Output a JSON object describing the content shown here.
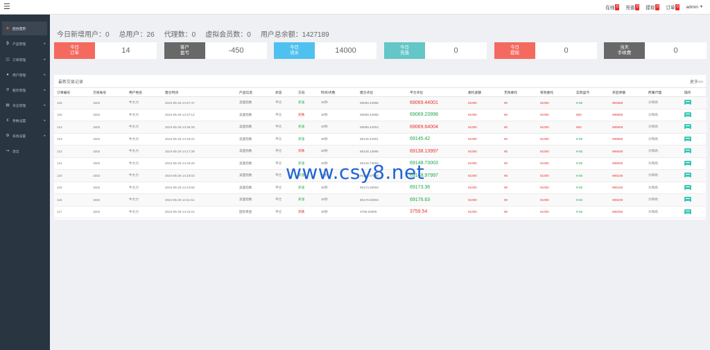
{
  "topbar": {
    "menu_icon": "hamburger-icon",
    "items": [
      {
        "label": "在线",
        "count": "0"
      },
      {
        "label": "充值",
        "count": "0"
      },
      {
        "label": "提现",
        "count": "0"
      },
      {
        "label": "订单",
        "count": "0"
      }
    ],
    "user": "admin"
  },
  "sidebar": {
    "items": [
      {
        "label": "后台首页",
        "icon": "dashboard-icon"
      },
      {
        "label": "产品管理",
        "icon": "product-icon"
      },
      {
        "label": "订单管理",
        "icon": "order-icon"
      },
      {
        "label": "用户管理",
        "icon": "user-icon"
      },
      {
        "label": "服务管理",
        "icon": "service-icon"
      },
      {
        "label": "日志管理",
        "icon": "log-icon"
      },
      {
        "label": "参数设置",
        "icon": "settings-icon"
      },
      {
        "label": "系统设置",
        "icon": "system-icon"
      },
      {
        "label": "退出",
        "icon": "logout-icon"
      }
    ]
  },
  "summary": {
    "new_users": "今日新增用户：0",
    "total_users": "总用户：26",
    "agents": "代理数：0",
    "virtual_members": "虚拟会员数：0",
    "total_balance": "用户总余额：1427189"
  },
  "cards": [
    {
      "label": "今日\n订单",
      "value": "14",
      "color": "#f46a5f"
    },
    {
      "label": "客户\n盈亏",
      "value": "-450",
      "color": "#686868"
    },
    {
      "label": "今日\n流水",
      "value": "14000",
      "color": "#4fc1f0"
    },
    {
      "label": "今日\n充值",
      "value": "0",
      "color": "#64c6c6"
    },
    {
      "label": "今日\n提现",
      "value": "0",
      "color": "#f46a5f"
    },
    {
      "label": "当天\n手续费",
      "value": "0",
      "color": "#686868"
    }
  ],
  "table": {
    "title": "最新交易记录",
    "more": "更多>>",
    "headers": [
      "订单编号",
      "交易账号",
      "用户姓名",
      "建仓时间",
      "产品信息",
      "状态",
      "方向",
      "时间/点数",
      "建仓点位",
      "平仓点位",
      "委托金额",
      "无效委托",
      "有效委托",
      "实际盈亏",
      "买后余额",
      "所属代理",
      "操作"
    ],
    "rows": [
      {
        "id": "126",
        "account": "1602",
        "name": "牛大力",
        "time": "2024-05-26 14:37:47",
        "product": "美国指数",
        "status": "平仓",
        "dir": "买涨",
        "dur": "30秒",
        "open": "69069.43998",
        "close": "69069.44001",
        "amount": "¥1000",
        "invalid": "¥0",
        "valid": "¥1000",
        "pnl": "¥-50",
        "balance": "¥94950",
        "agent": "沙和尚"
      },
      {
        "id": "125",
        "account": "1602",
        "name": "牛大力",
        "time": "2024-05-26 14:37:12",
        "product": "美国指数",
        "status": "平仓",
        "dir": "买跌",
        "dur": "30秒",
        "open": "69069.43998",
        "close": "69069.23998",
        "amount": "¥1000",
        "invalid": "¥0",
        "valid": "¥1000",
        "pnl": "¥50",
        "balance": "¥95950",
        "agent": "沙和尚"
      },
      {
        "id": "124",
        "account": "1602",
        "name": "牛大力",
        "time": "2024-05-26 14:36:29",
        "product": "美国指数",
        "status": "平仓",
        "dir": "买涨",
        "dur": "30秒",
        "open": "69069.44004",
        "close": "69069.64004",
        "amount": "¥1000",
        "invalid": "¥0",
        "valid": "¥1000",
        "pnl": "¥50",
        "balance": "¥95900",
        "agent": "沙和尚"
      },
      {
        "id": "123",
        "account": "1602",
        "name": "牛大力",
        "time": "2024-05-26 14:18:22",
        "product": "美国指数",
        "status": "平仓",
        "dir": "买涨",
        "dur": "30秒",
        "open": "69145.42001",
        "close": "69145.42",
        "amount": "¥1000",
        "invalid": "¥0",
        "valid": "¥1000",
        "pnl": "¥-50",
        "balance": "¥95950",
        "agent": "沙和尚"
      },
      {
        "id": "122",
        "account": "1602",
        "name": "牛大力",
        "time": "2024-05-26 14:17:39",
        "product": "美国指数",
        "status": "平仓",
        "dir": "买跌",
        "dur": "30秒",
        "open": "69138.13995",
        "close": "69138.13997",
        "amount": "¥1000",
        "invalid": "¥0",
        "valid": "¥1000",
        "pnl": "¥-50",
        "balance": "¥96000",
        "agent": "沙和尚"
      },
      {
        "id": "121",
        "account": "1602",
        "name": "牛大力",
        "time": "2024-05-26 14:16:20",
        "product": "美国指数",
        "status": "平仓",
        "dir": "买涨",
        "dur": "30秒",
        "open": "69148.73006",
        "close": "69148.73003",
        "amount": "¥1000",
        "invalid": "¥0",
        "valid": "¥1000",
        "pnl": "¥-50",
        "balance": "¥96050",
        "agent": "沙和尚"
      },
      {
        "id": "120",
        "account": "1602",
        "name": "牛大力",
        "time": "2024-05-26 14:15:03",
        "product": "美国指数",
        "status": "平仓",
        "dir": "买涨",
        "dur": "30秒",
        "open": "69148.97998",
        "close": "69148.97997",
        "amount": "¥1000",
        "invalid": "¥0",
        "valid": "¥1000",
        "pnl": "¥-50",
        "balance": "¥96100",
        "agent": "沙和尚"
      },
      {
        "id": "119",
        "account": "1602",
        "name": "牛大力",
        "time": "2024-05-26 14:13:55",
        "product": "美国指数",
        "status": "平仓",
        "dir": "买涨",
        "dur": "30秒",
        "open": "69173.36003",
        "close": "69173.36",
        "amount": "¥1000",
        "invalid": "¥0",
        "valid": "¥1000",
        "pnl": "¥-50",
        "balance": "¥96150",
        "agent": "沙和尚"
      },
      {
        "id": "118",
        "account": "1602",
        "name": "牛大力",
        "time": "2024-05-26 14:11:51",
        "product": "美国指数",
        "status": "平仓",
        "dir": "买涨",
        "dur": "30秒",
        "open": "69176.63003",
        "close": "69176.63",
        "amount": "¥1000",
        "invalid": "¥0",
        "valid": "¥1000",
        "pnl": "¥-50",
        "balance": "¥96200",
        "agent": "沙和尚"
      },
      {
        "id": "117",
        "account": "1602",
        "name": "牛大力",
        "time": "2024-05-26 14:10:24",
        "product": "国际黄金",
        "status": "平仓",
        "dir": "买跌",
        "dur": "30秒",
        "open": "3759.53999",
        "close": "3759.54",
        "amount": "¥1000",
        "invalid": "¥0",
        "valid": "¥1000",
        "pnl": "¥-50",
        "balance": "¥96250",
        "agent": "沙和尚"
      }
    ]
  },
  "watermark": "www.csy8.net"
}
